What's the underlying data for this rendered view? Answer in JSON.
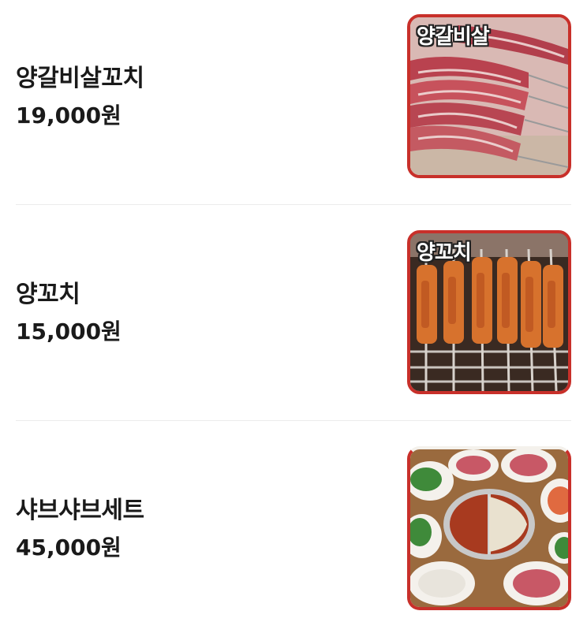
{
  "menu": {
    "items": [
      {
        "name": "양갈비살꼬치",
        "price": "19,000원",
        "image_caption": "양갈비살",
        "image_icon": "lamb-rib-skewers-photo"
      },
      {
        "name": "양꼬치",
        "price": "15,000원",
        "image_caption": "양꼬치",
        "image_icon": "lamb-skewers-grill-photo"
      },
      {
        "name": "샤브샤브세트",
        "price": "45,000원",
        "image_icon": "hotpot-shabu-set-photo"
      }
    ]
  },
  "colors": {
    "frame": "#c8302a",
    "text": "#1a1a1a",
    "divider": "#ececec"
  }
}
